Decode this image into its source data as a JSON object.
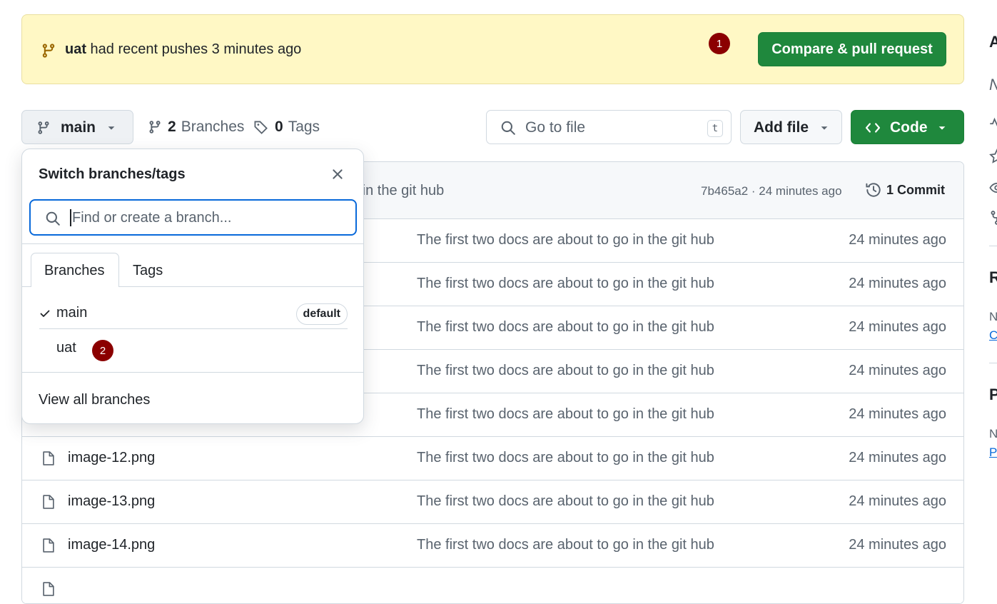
{
  "colors": {
    "banner_bg": "#fff8c5",
    "primary_green": "#1f883d",
    "annotation_badge": "#8b0000",
    "focus_blue": "#0969da",
    "muted_text": "#59636e"
  },
  "banner": {
    "branch": "uat",
    "message": " had recent pushes 3 minutes ago",
    "step_badge": "1",
    "compare_button": "Compare & pull request",
    "icon": "git-branch-icon"
  },
  "toolbar": {
    "branch_selector": "main",
    "branches_count": "2",
    "branches_label": "Branches",
    "tags_count": "0",
    "tags_label": "Tags",
    "go_to_file_placeholder": "Go to file",
    "go_to_file_shortcut": "t",
    "add_file": "Add file",
    "code": "Code"
  },
  "commit_header": {
    "message_fragment": "o in the git hub",
    "hash_time": "7b465a2 · 24 minutes ago",
    "commits": "1 Commit"
  },
  "files": [
    {
      "name": "",
      "message": "The first two docs are about to go in the git hub",
      "date": "24 minutes ago"
    },
    {
      "name": "",
      "message": "The first two docs are about to go in the git hub",
      "date": "24 minutes ago"
    },
    {
      "name": "",
      "message": "The first two docs are about to go in the git hub",
      "date": "24 minutes ago"
    },
    {
      "name": "",
      "message": "The first two docs are about to go in the git hub",
      "date": "24 minutes ago"
    },
    {
      "name": "",
      "message": "The first two docs are about to go in the git hub",
      "date": "24 minutes ago"
    },
    {
      "name": "image-12.png",
      "message": "The first two docs are about to go in the git hub",
      "date": "24 minutes ago"
    },
    {
      "name": "image-13.png",
      "message": "The first two docs are about to go in the git hub",
      "date": "24 minutes ago"
    },
    {
      "name": "image-14.png",
      "message": "The first two docs are about to go in the git hub",
      "date": "24 minutes ago"
    }
  ],
  "dropdown": {
    "title": "Switch branches/tags",
    "search_placeholder": "Find or create a branch...",
    "tabs": [
      "Branches",
      "Tags"
    ],
    "branches": [
      {
        "name": "main",
        "selected": true,
        "badge": "default"
      },
      {
        "name": "uat",
        "selected": false,
        "step_badge": "2"
      }
    ],
    "footer": "View all branches"
  },
  "sidebar_partial": [
    "A",
    "N",
    "R",
    "N",
    "C",
    "P",
    "N",
    "P"
  ]
}
